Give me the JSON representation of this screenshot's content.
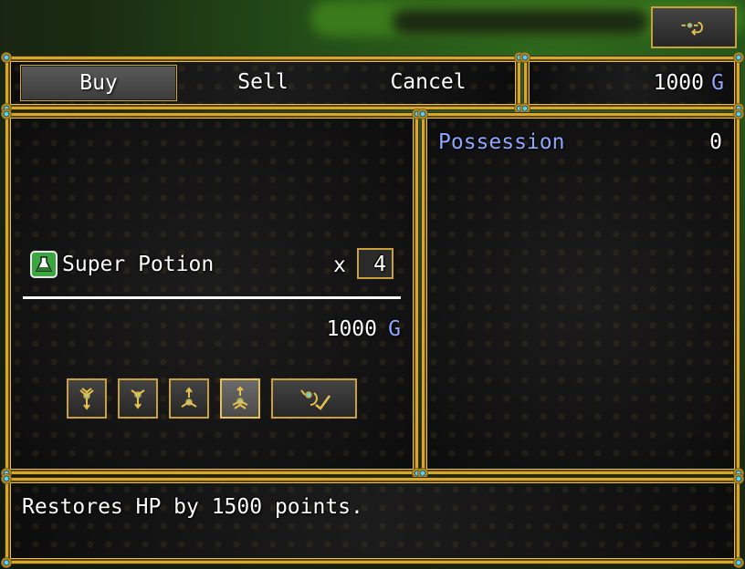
{
  "commands": {
    "buy": "Buy",
    "sell": "Sell",
    "cancel": "Cancel"
  },
  "gold": {
    "value": "1000",
    "unit": "G"
  },
  "item": {
    "name": "Super Potion",
    "times": "x",
    "quantity": "4",
    "total": "1000",
    "unit": "G"
  },
  "status": {
    "possession_label": "Possession",
    "possession_value": "0"
  },
  "help": {
    "text": "Restores HP by 1500 points."
  },
  "icons": {
    "back": "back-arrow-icon",
    "potion": "potion-icon",
    "max_down": "double-down-icon",
    "down": "down-icon",
    "up": "up-icon",
    "max_up": "double-up-icon",
    "ok": "ok-icon"
  },
  "colors": {
    "frame": "#d4a82c",
    "system_text": "#8fa8ff",
    "window": "#141414"
  }
}
